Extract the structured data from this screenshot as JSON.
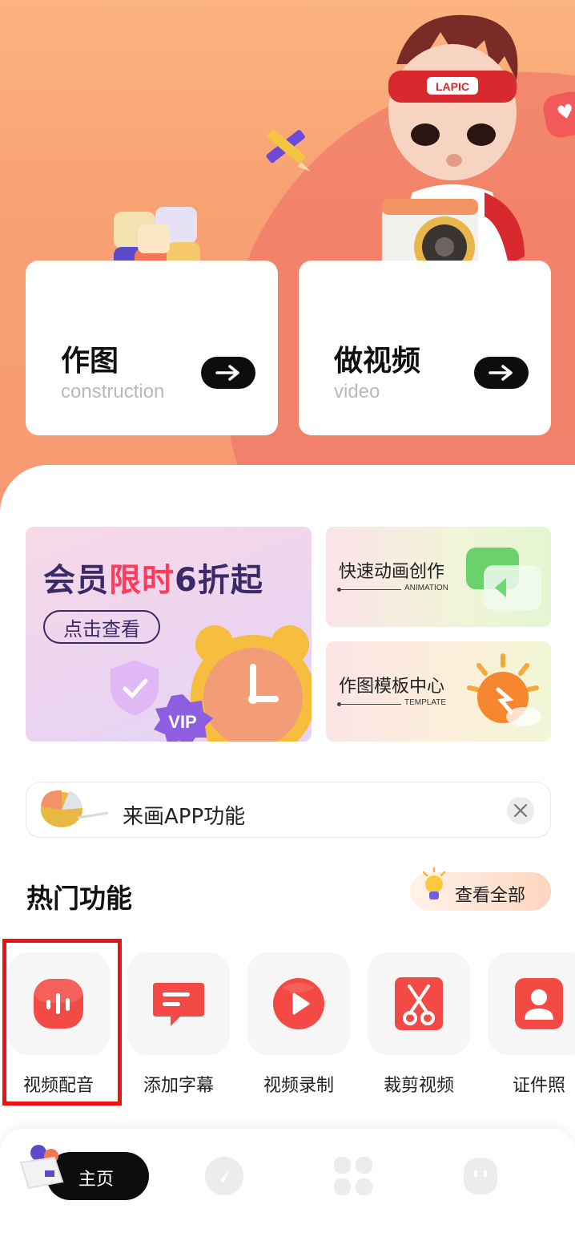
{
  "hero": {
    "card_left": {
      "title": "作图",
      "subtitle": "construction"
    },
    "card_right": {
      "title": "做视频",
      "subtitle": "video"
    },
    "mascot_badge": "LAPIC"
  },
  "promo": {
    "big": {
      "title_a": "会员",
      "title_highlight": "限时",
      "title_b": "6折起",
      "button": "点击查看",
      "badge": "VIP"
    },
    "animation": {
      "title": "快速动画创作",
      "subtitle": "ANIMATION"
    },
    "template": {
      "title": "作图模板中心",
      "subtitle": "TEMPLATE"
    }
  },
  "notice": {
    "text": "来画APP功能"
  },
  "hot": {
    "title": "热门功能",
    "view_all": "查看全部",
    "features": [
      {
        "label": "视频配音",
        "icon": "audio-wave-icon"
      },
      {
        "label": "添加字幕",
        "icon": "subtitle-icon"
      },
      {
        "label": "视频录制",
        "icon": "play-record-icon"
      },
      {
        "label": "裁剪视频",
        "icon": "scissors-icon"
      },
      {
        "label": "证件照",
        "icon": "id-photo-icon"
      }
    ]
  },
  "nav": {
    "home": "主页"
  },
  "colors": {
    "accent": "#f44a45",
    "hero": "#f8a173",
    "dark": "#0d0d0d",
    "highlight_box": "#ee1111"
  }
}
